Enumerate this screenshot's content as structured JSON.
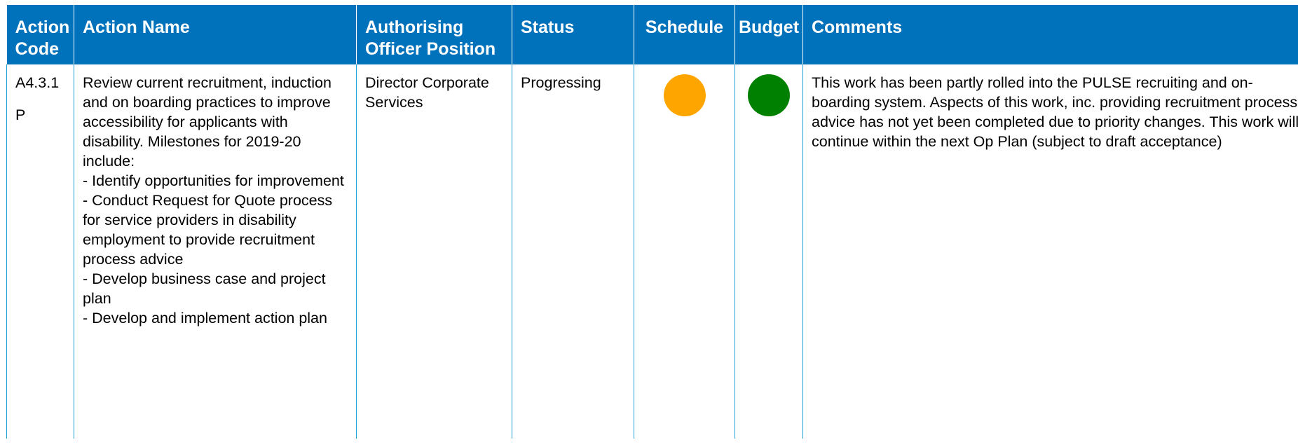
{
  "table": {
    "headers": {
      "action_code": "Action Code",
      "action_name": "Action Name",
      "authorising_officer": "Authorising Officer Position",
      "status": "Status",
      "schedule": "Schedule",
      "budget": "Budget",
      "comments": "Comments"
    },
    "rows": [
      {
        "action_code_line1": "A4.3.1",
        "action_code_line2": "P",
        "action_name": "Review current recruitment, induction and on boarding practices to improve accessibility for applicants with disability. Milestones for 2019-20 include:\n- Identify opportunities for improvement\n- Conduct Request for Quote process for service providers in disability employment to provide recruitment process advice\n- Develop business case and project plan\n- Develop and implement action plan",
        "authorising_officer": "Director Corporate Services",
        "status": "Progressing",
        "schedule_rag": "amber",
        "schedule_color": "#ffa500",
        "budget_rag": "green",
        "budget_color": "#008000",
        "comments": "This work has been partly rolled into the PULSE recruiting and on-boarding system.  Aspects of this work, inc. providing recruitment process advice has not yet been completed due to priority changes.  This work will continue within the next Op Plan (subject to draft acceptance)"
      }
    ]
  }
}
